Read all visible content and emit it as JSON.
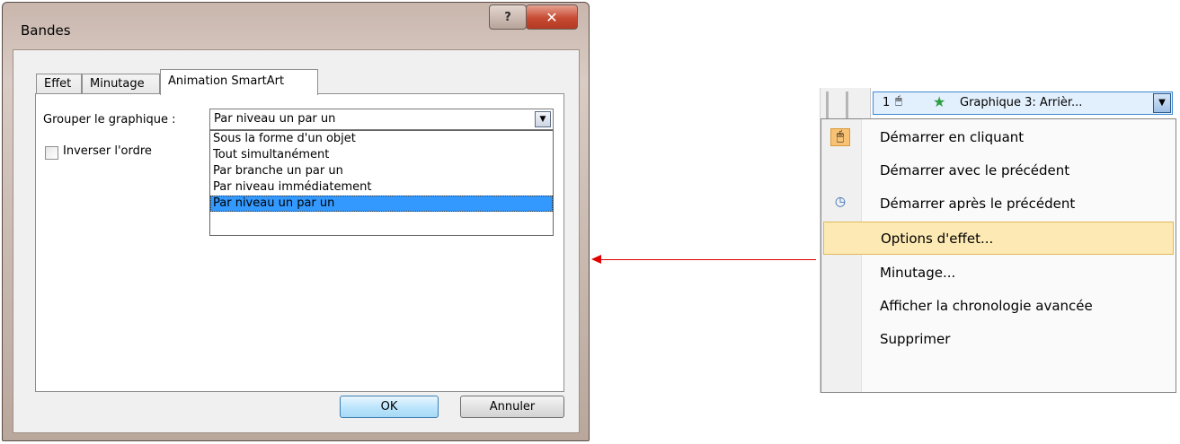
{
  "dialog": {
    "title": "Bandes",
    "help_label": "?",
    "close_label": "✕",
    "tabs": [
      {
        "label": "Effet"
      },
      {
        "label": "Minutage"
      },
      {
        "label": "Animation SmartArt"
      }
    ],
    "group_label": "Grouper le graphique :",
    "group_value": "Par niveau un par un",
    "dropdown_options": [
      "Sous la forme d'un objet",
      "Tout simultanément",
      "Par branche un par un",
      "Par niveau immédiatement",
      "Par niveau un par un"
    ],
    "selected_option": "Par niveau un par un",
    "checkbox_label": "Inverser l'ordre",
    "checkbox_checked": false,
    "ok_label": "OK",
    "cancel_label": "Annuler"
  },
  "animation_pane": {
    "item_number": "1",
    "item_icon": "mouse-icon",
    "effect_icon": "star-icon",
    "item_label": "Graphique 3: Arrièr..."
  },
  "context_menu": {
    "items": [
      {
        "label": "Démarrer en cliquant",
        "icon": "mouse-icon"
      },
      {
        "label": "Démarrer avec le précédent",
        "icon": ""
      },
      {
        "label": "Démarrer après le précédent",
        "icon": "clock-icon"
      },
      {
        "label": "Options d'effet...",
        "icon": "",
        "highlighted": true
      },
      {
        "label": "Minutage...",
        "icon": ""
      },
      {
        "label": "Afficher la chronologie avancée",
        "icon": ""
      },
      {
        "label": "Supprimer",
        "icon": ""
      }
    ]
  },
  "colors": {
    "arrow": "#e00000",
    "selection": "#3399ff",
    "menu_highlight": "#fce9b3"
  }
}
